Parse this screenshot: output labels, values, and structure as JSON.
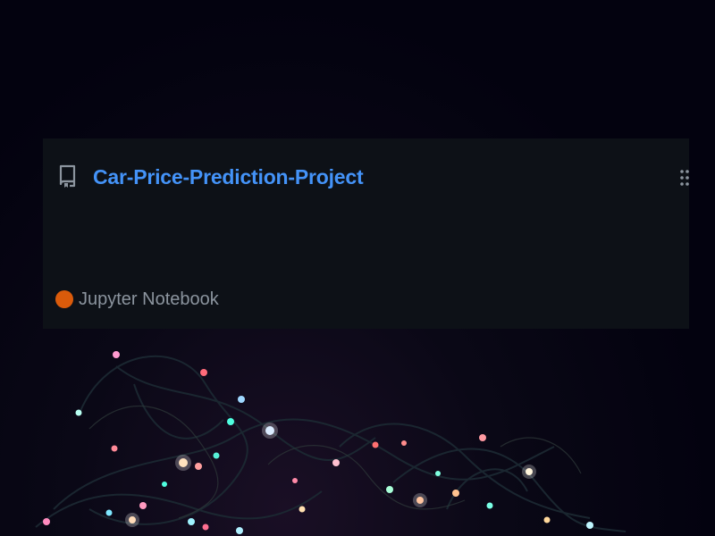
{
  "repo_card": {
    "name": "Car-Price-Prediction-Project",
    "language": {
      "name": "Jupyter Notebook",
      "color": "#DA5B0B"
    },
    "icons": {
      "repo": "repo-icon",
      "drag": "grabber-icon"
    }
  },
  "colors": {
    "card_background": "#0d1117",
    "link": "#4493f8",
    "muted_text": "#8b949e",
    "page_background": "#03020f"
  }
}
